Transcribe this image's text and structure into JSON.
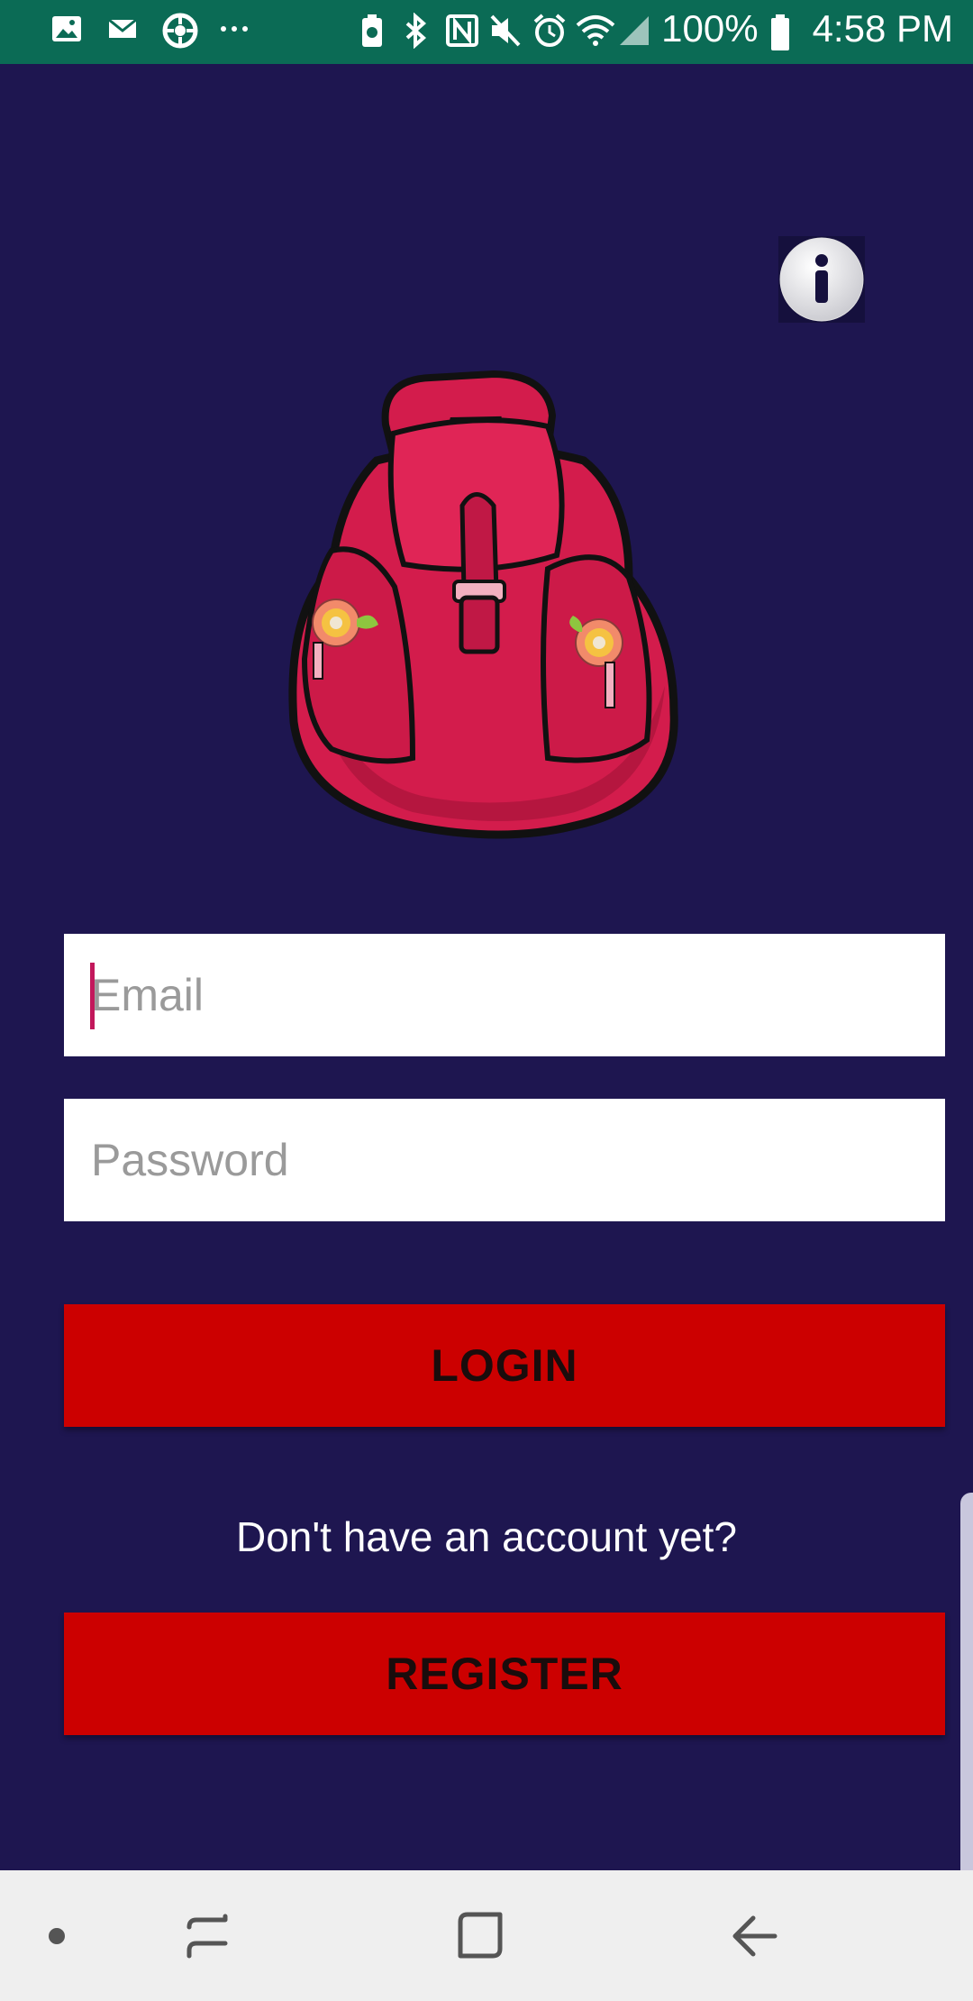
{
  "status_bar": {
    "battery_percent": "100%",
    "time": "4:58 PM",
    "left_icons": [
      "gallery-icon",
      "mail-icon",
      "settings-wheel-icon",
      "more-dots-icon"
    ],
    "right_icons": [
      "battery-saver-icon",
      "bluetooth-icon",
      "nfc-icon",
      "mute-icon",
      "alarm-icon",
      "wifi-icon",
      "signal-icon",
      "battery-icon"
    ]
  },
  "login_form": {
    "email_placeholder": "Email",
    "password_placeholder": "Password",
    "login_label": "LOGIN",
    "no_account_text": "Don't have an account yet?",
    "register_label": "REGISTER"
  },
  "icons": {
    "info": "info-icon",
    "logo": "backpack-logo"
  },
  "colors": {
    "background": "#1e1650",
    "status_bar": "#0b6b55",
    "button": "#cc0000",
    "caret": "#c2185b",
    "nav_bar": "#efefef"
  },
  "nav_bar": {
    "items": [
      "dot-icon",
      "recent-apps-icon",
      "home-icon",
      "back-icon"
    ]
  }
}
